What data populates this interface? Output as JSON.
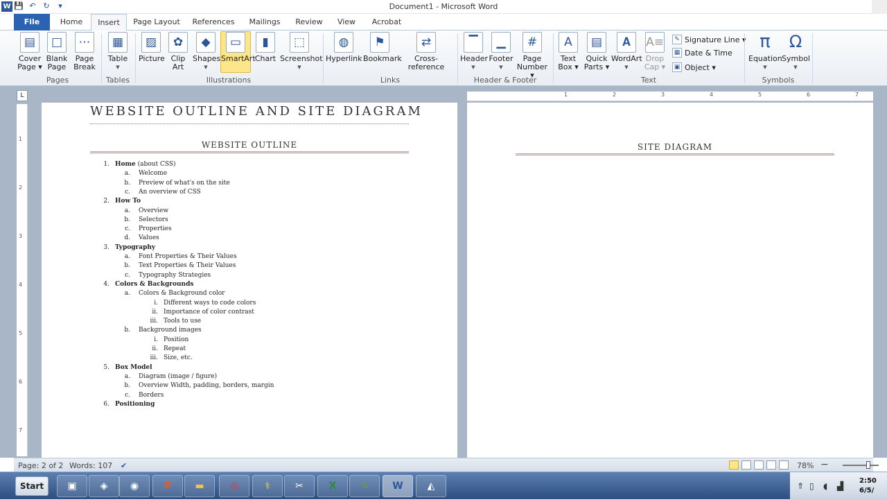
{
  "window": {
    "title": "Document1  -  Microsoft Word",
    "app_letter": "W"
  },
  "qat": {
    "save": "💾",
    "undo": "↶",
    "redo": "↻",
    "more": "▾"
  },
  "tabs": [
    "File",
    "Home",
    "Insert",
    "Page Layout",
    "References",
    "Mailings",
    "Review",
    "View",
    "Acrobat"
  ],
  "active_tab": "Insert",
  "ribbon": {
    "pages": {
      "group": "Pages",
      "cover": [
        "Cover",
        "Page ▾"
      ],
      "blank": [
        "Blank",
        "Page"
      ],
      "break": [
        "Page",
        "Break"
      ]
    },
    "tables": {
      "group": "Tables",
      "table": "Table"
    },
    "illustrations": {
      "group": "Illustrations",
      "picture": "Picture",
      "clipart": [
        "Clip",
        "Art"
      ],
      "shapes": "Shapes",
      "smartart": "SmartArt",
      "chart": "Chart",
      "screenshot": "Screenshot"
    },
    "links": {
      "group": "Links",
      "hyperlink": "Hyperlink",
      "bookmark": "Bookmark",
      "crossref": "Cross-reference"
    },
    "headerfooter": {
      "group": "Header & Footer",
      "header": "Header",
      "footer": "Footer",
      "pagenumber": [
        "Page",
        "Number ▾"
      ]
    },
    "text": {
      "group": "Text",
      "textbox": [
        "Text",
        "Box ▾"
      ],
      "quickparts": [
        "Quick",
        "Parts ▾"
      ],
      "wordart": "WordArt",
      "dropcap": [
        "Drop",
        "Cap ▾"
      ],
      "signature": "Signature Line ▾",
      "datetime": "Date & Time",
      "object": "Object ▾"
    },
    "symbols": {
      "group": "Symbols",
      "equation": "Equation",
      "symbol": "Symbol"
    }
  },
  "ruler": {
    "button": "L",
    "h_ticks": [
      "1",
      "2",
      "3",
      "4",
      "5",
      "6",
      "7"
    ],
    "v_ticks": [
      "1",
      "2",
      "3",
      "4",
      "5",
      "6",
      "7"
    ]
  },
  "page1": {
    "title": "WEBSITE OUTLINE AND SITE DIAGRAM",
    "heading": "WEBSITE OUTLINE",
    "outline": [
      {
        "lvl": 1,
        "n": "1.",
        "t": "Home",
        "extra": " (about CSS)"
      },
      {
        "lvl": 2,
        "n": "a.",
        "t": "Welcome"
      },
      {
        "lvl": 2,
        "n": "b.",
        "t": "Preview of what's on the site"
      },
      {
        "lvl": 2,
        "n": "c.",
        "t": "An overview of CSS"
      },
      {
        "lvl": 1,
        "n": "2.",
        "t": "How To"
      },
      {
        "lvl": 2,
        "n": "a.",
        "t": "Overview"
      },
      {
        "lvl": 2,
        "n": "b.",
        "t": "Selectors"
      },
      {
        "lvl": 2,
        "n": "c.",
        "t": "Properties"
      },
      {
        "lvl": 2,
        "n": "d.",
        "t": "Values"
      },
      {
        "lvl": 1,
        "n": "3.",
        "t": "Typography"
      },
      {
        "lvl": 2,
        "n": "a.",
        "t": "Font Properties & Their Values"
      },
      {
        "lvl": 2,
        "n": "b.",
        "t": "Text Properties & Their Values"
      },
      {
        "lvl": 2,
        "n": "c.",
        "t": "Typography Strategies"
      },
      {
        "lvl": 1,
        "n": "4.",
        "t": "Colors & Backgrounds"
      },
      {
        "lvl": 2,
        "n": "a.",
        "t": "Colors & Background  color"
      },
      {
        "lvl": 3,
        "n": "i.",
        "t": "Different  ways to code colors"
      },
      {
        "lvl": 3,
        "n": "ii.",
        "t": "Importance of color contrast"
      },
      {
        "lvl": 3,
        "n": "iii.",
        "t": "Tools to use"
      },
      {
        "lvl": 2,
        "n": "b.",
        "t": "Background  images"
      },
      {
        "lvl": 3,
        "n": "i.",
        "t": "Position"
      },
      {
        "lvl": 3,
        "n": "ii.",
        "t": "Repeat"
      },
      {
        "lvl": 3,
        "n": "iii.",
        "t": "Size, etc."
      },
      {
        "lvl": 1,
        "n": "5.",
        "t": "Box Model"
      },
      {
        "lvl": 2,
        "n": "a.",
        "t": "Diagram  (image  / figure)"
      },
      {
        "lvl": 2,
        "n": "b.",
        "t": "Overview Width, padding, borders, margin"
      },
      {
        "lvl": 2,
        "n": "c.",
        "t": "Borders"
      },
      {
        "lvl": 1,
        "n": "6.",
        "t": "Positioning"
      }
    ]
  },
  "page2": {
    "heading": "SITE DIAGRAM"
  },
  "status": {
    "page": "Page: 2 of 2",
    "words": "Words: 107",
    "zoom": "78%",
    "minus": "−",
    "plus": "+"
  },
  "taskbar": {
    "start": "Start",
    "clock_time": "2:50",
    "clock_date": "6/5/"
  }
}
